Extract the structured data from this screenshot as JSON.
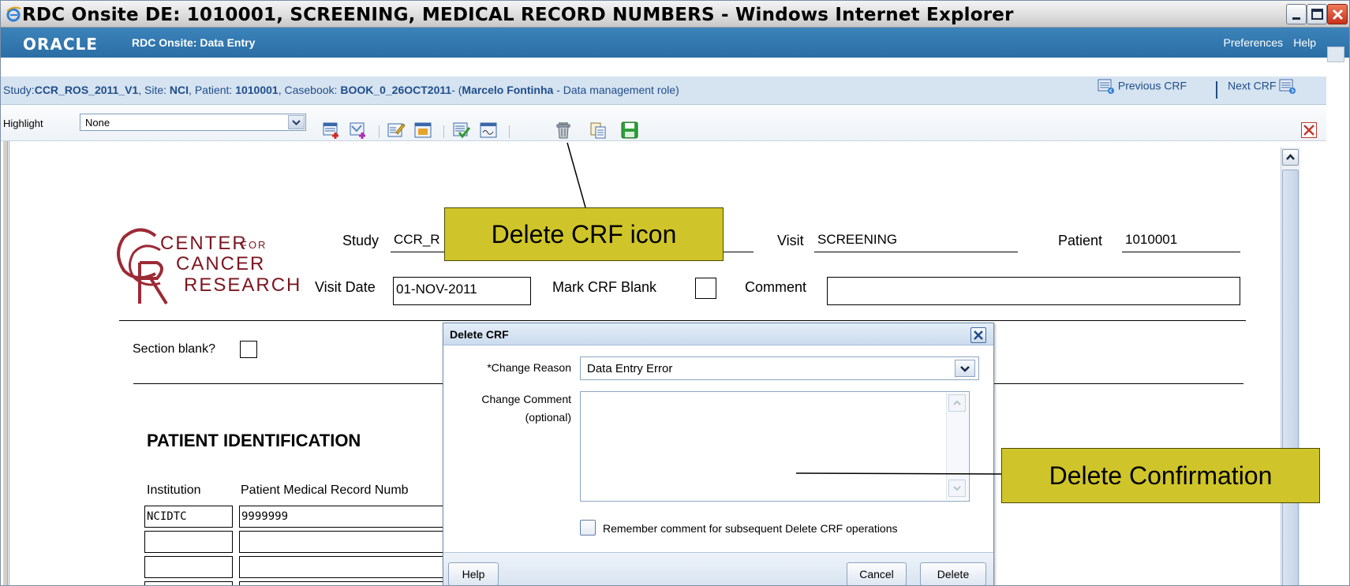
{
  "window": {
    "title": "RDC Onsite DE: 1010001, SCREENING, MEDICAL RECORD NUMBERS - Windows Internet Explorer"
  },
  "header": {
    "logo_text": "ORACLE",
    "app_title": "RDC Onsite: Data Entry",
    "preferences_label": "Preferences",
    "help_label": "Help"
  },
  "context": {
    "study_prefix": "Study:",
    "study": "CCR_ROS_2011_V1",
    "site_prefix": ", Site: ",
    "site": "NCI",
    "patient_prefix": ", Patient: ",
    "patient": "1010001",
    "casebook_prefix": ", Casebook: ",
    "casebook": "BOOK_0_26OCT2011",
    "user_prefix": "- (",
    "user": "Marcelo Fontinha",
    "role": " - Data management role)",
    "prev_crf": "Previous CRF",
    "next_crf": "Next CRF"
  },
  "toolbar": {
    "highlight_label": "Highlight",
    "highlight_value": "None"
  },
  "form": {
    "logo_text_1": "CENTER",
    "logo_text_for": "FOR",
    "logo_text_2": "CANCER",
    "logo_text_3": "RESEARCH",
    "study_label": "Study",
    "study_value": "CCR_R",
    "visit_label": "Visit",
    "visit_value": "SCREENING",
    "patient_label": "Patient",
    "patient_value": "1010001",
    "visit_date_label": "Visit Date",
    "visit_date_value": "01-NOV-2011",
    "mark_blank_label": "Mark CRF Blank",
    "comment_label": "Comment",
    "comment_value": "",
    "section_blank_label": "Section blank?",
    "section_title": "PATIENT IDENTIFICATION",
    "col_institution": "Institution",
    "col_mrn": "Patient Medical Record Numb",
    "rows": [
      {
        "institution": "NCIDTC",
        "mrn": "9999999"
      },
      {
        "institution": "",
        "mrn": ""
      },
      {
        "institution": "",
        "mrn": ""
      },
      {
        "institution": "",
        "mrn": ""
      }
    ]
  },
  "dialog": {
    "title": "Delete CRF",
    "reason_label": "*Change Reason",
    "reason_value": "Data Entry Error",
    "comment_label": "Change Comment",
    "comment_optional": "(optional)",
    "comment_value": "",
    "remember_label": "Remember comment for subsequent Delete CRF operations",
    "remember_checked": false,
    "help_button": "Help",
    "cancel_button": "Cancel",
    "delete_button": "Delete"
  },
  "callouts": {
    "delete_icon": "Delete CRF icon",
    "delete_confirm": "Delete Confirmation"
  },
  "colors": {
    "oracle_blue": "#2b6ea5",
    "context_bg": "#d6e3f0",
    "callout": "#cfc52a",
    "logo_red": "#9c2a35"
  }
}
